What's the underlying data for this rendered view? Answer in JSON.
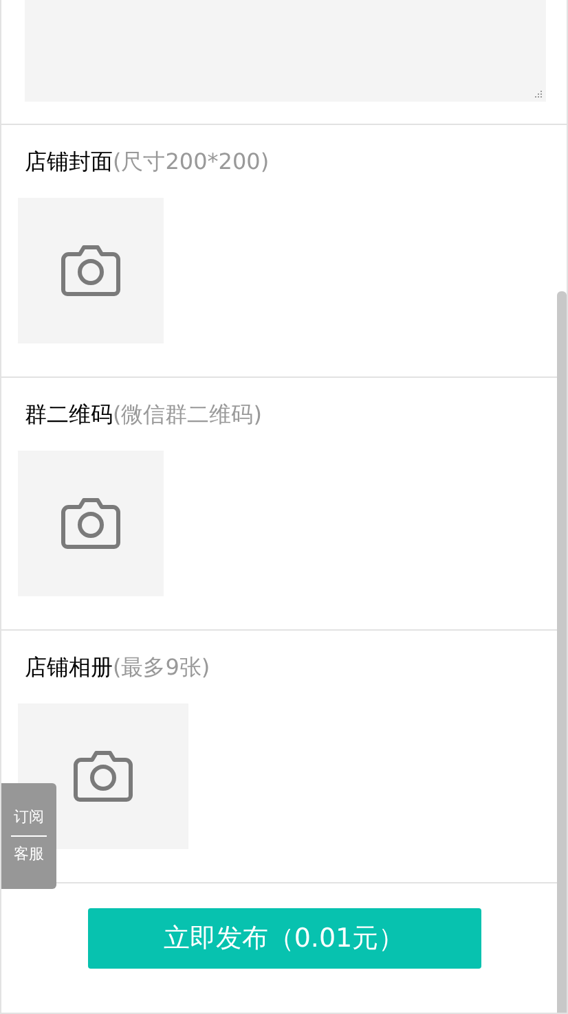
{
  "sections": [
    {
      "title": "店铺封面",
      "hint": "(尺寸200*200)"
    },
    {
      "title": "群二维码",
      "hint": "(微信群二维码)"
    },
    {
      "title": "店铺相册",
      "hint": "(最多9张)"
    }
  ],
  "side_tab": {
    "top": "订阅",
    "bottom": "客服"
  },
  "submit_button": "立即发布（0.01元）"
}
